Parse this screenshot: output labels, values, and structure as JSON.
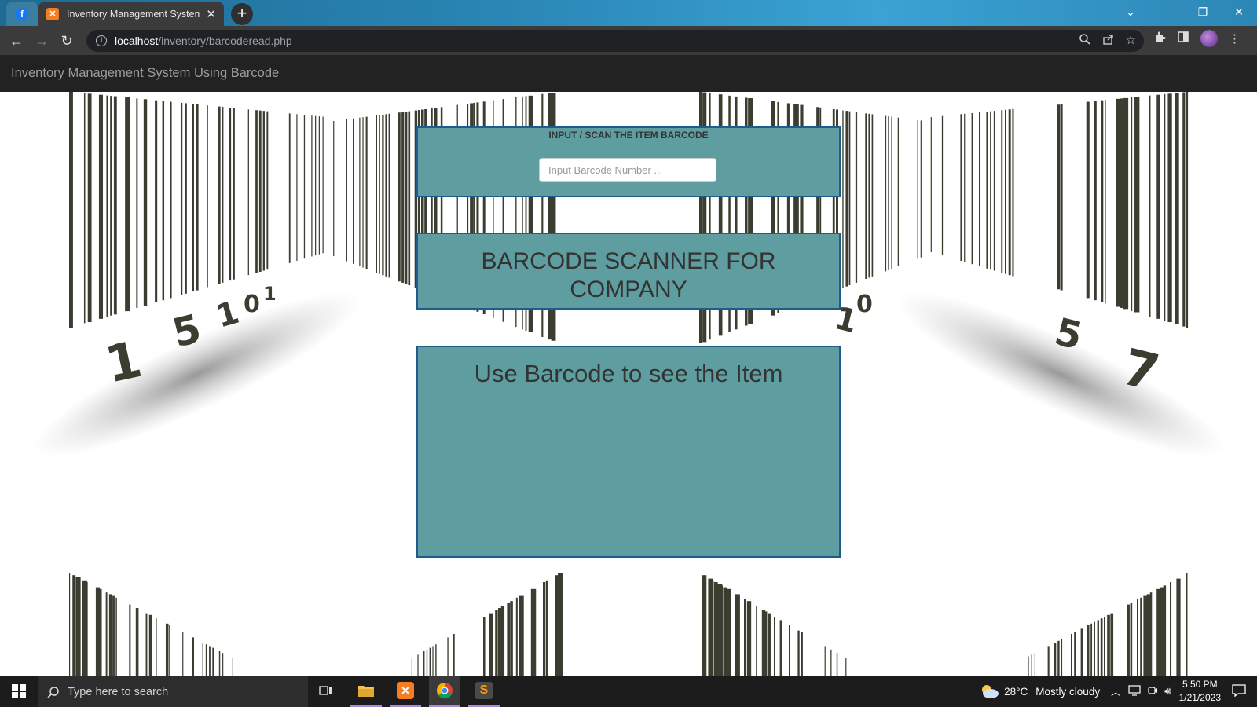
{
  "browser": {
    "tabs": [
      {
        "title": "Inventory Management System U",
        "active": true
      }
    ],
    "url_host": "localhost",
    "url_path": "/inventory/barcoderead.php"
  },
  "page": {
    "brand": "Inventory Management System Using Barcode",
    "input_panel": {
      "caption": "INPUT / SCAN THE ITEM BARCODE",
      "placeholder": "Input Barcode Number ...",
      "value": ""
    },
    "title_panel": {
      "line1": "BARCODE SCANNER FOR",
      "line2": "COMPANY"
    },
    "result_panel": {
      "heading": "Use Barcode to see the Item"
    }
  },
  "taskbar": {
    "search_placeholder": "Type here to search",
    "weather_temp": "28°C",
    "weather_desc": "Mostly cloudy",
    "time": "5:50 PM",
    "date": "1/21/2023"
  },
  "colors": {
    "panel_bg": "#5f9ea0",
    "panel_border": "#1f5c8a",
    "navbar_bg": "#222222"
  }
}
